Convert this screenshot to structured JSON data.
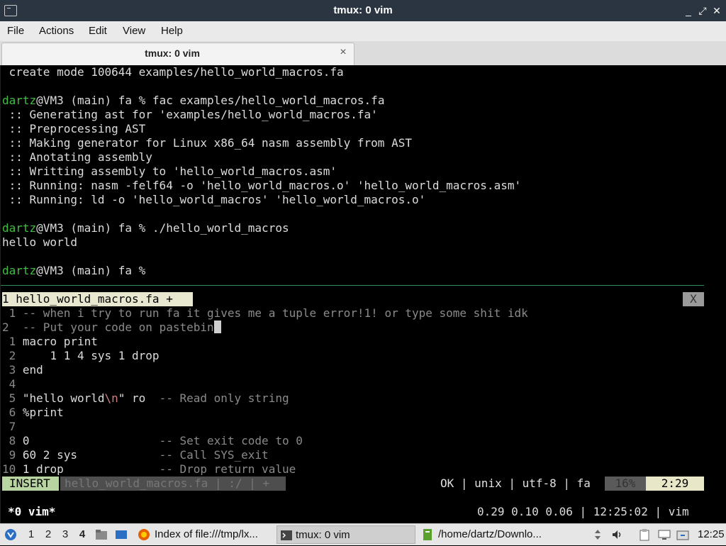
{
  "window": {
    "title": "tmux: 0 vim",
    "controls": [
      "_",
      "⤢",
      "✕"
    ]
  },
  "menu": [
    "File",
    "Actions",
    "Edit",
    "View",
    "Help"
  ],
  "tab": {
    "label": "tmux: 0 vim",
    "close": "×"
  },
  "terminal": {
    "lines": [
      {
        "text": " create mode 100644 examples/hello_world_macros.fa"
      },
      {
        "text": ""
      },
      {
        "prompt": "dartz",
        "text": "@VM3 (main) fa % fac examples/hello_world_macros.fa"
      },
      {
        "text": " :: Generating ast for 'examples/hello_world_macros.fa'"
      },
      {
        "text": " :: Preprocessing AST"
      },
      {
        "text": " :: Making generator for Linux x86_64 nasm assembly from AST"
      },
      {
        "text": " :: Anotating assembly"
      },
      {
        "text": " :: Writting assembly to 'hello_world_macros.asm'"
      },
      {
        "text": " :: Running: nasm -felf64 -o 'hello_world_macros.o' 'hello_world_macros.asm'"
      },
      {
        "text": " :: Running: ld -o 'hello_world_macros' 'hello_world_macros.o'"
      },
      {
        "text": ""
      },
      {
        "prompt": "dartz",
        "text": "@VM3 (main) fa % ./hello_world_macros"
      },
      {
        "text": "hello world"
      },
      {
        "text": ""
      },
      {
        "prompt": "dartz",
        "text": "@VM3 (main) fa %"
      }
    ]
  },
  "vim": {
    "buffer_tab": "1 hello_world_macros.fa +",
    "buffer_close": "X",
    "lines": [
      {
        "num": " 1 ",
        "code": "-- when i try to run fa it gives me a tuple error!1! or type some shit idk",
        "comment": true
      },
      {
        "num": "2  ",
        "code": "-- Put your code on pastebin",
        "comment": true,
        "cursor": true
      },
      {
        "num": " 1 ",
        "code": "macro print"
      },
      {
        "num": " 2 ",
        "code": "    1 1 4 sys 1 drop"
      },
      {
        "num": " 3 ",
        "code": "end"
      },
      {
        "num": " 4 ",
        "code": ""
      },
      {
        "num": " 5 ",
        "code_pre": "\"hello world",
        "code_esc": "\\n",
        "code_post": "\" ro  ",
        "code_cmt": "-- Read only string"
      },
      {
        "num": " 6 ",
        "code": "%print"
      },
      {
        "num": " 7 ",
        "code": ""
      },
      {
        "num": " 8 ",
        "code_pre": "0                   ",
        "code_cmt": "-- Set exit code to 0"
      },
      {
        "num": " 9 ",
        "code_pre": "60 2 sys            ",
        "code_cmt": "-- Call SYS_exit"
      },
      {
        "num": "10 ",
        "code_pre": "1 drop              ",
        "code_cmt": "-- Drop return value"
      }
    ],
    "status": {
      "mode": "INSERT",
      "file": "hello_world_macros.fa | :/ | +",
      "right": "OK | unix | utf-8 | fa",
      "percent": "16%",
      "position": "2:29"
    }
  },
  "tmux": {
    "left": "*0 vim*",
    "right": "0.29 0.10 0.06 | 12:25:02 | vim"
  },
  "taskbar": {
    "workspaces": [
      "1",
      "2",
      "3",
      "4"
    ],
    "active_workspace": "4",
    "tasks": [
      {
        "label": "Index of file:///tmp/lx...",
        "icon": "firefox-icon"
      },
      {
        "label": "tmux: 0 vim",
        "icon": "terminal-icon"
      },
      {
        "label": "/home/dartz/Downlo...",
        "icon": "file-manager-icon"
      }
    ],
    "clock": "12:25"
  }
}
